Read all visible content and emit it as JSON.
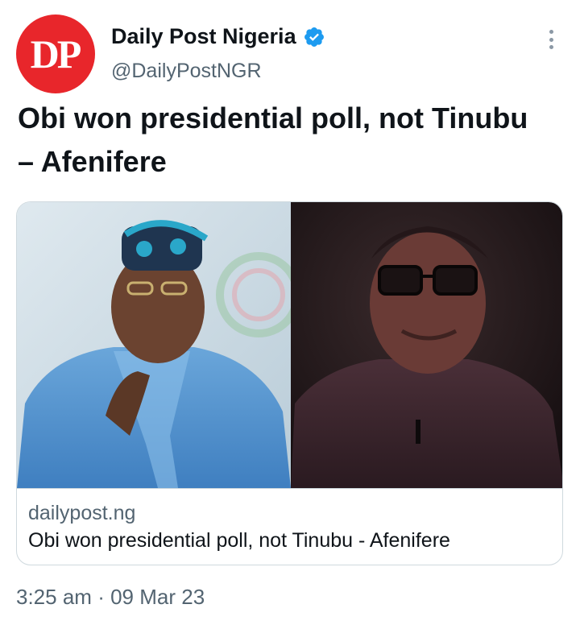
{
  "author": {
    "display_name": "Daily Post Nigeria",
    "handle": "@DailyPostNGR",
    "avatar_text": "DP",
    "verified": true
  },
  "tweet": {
    "text": "Obi won presidential poll, not Tinubu – Afenifere"
  },
  "card": {
    "domain": "dailypost.ng",
    "title": "Obi won presidential poll, not Tinubu - Afenifere"
  },
  "meta": {
    "time": "3:25 am",
    "separator": "·",
    "date": "09 Mar 23"
  },
  "colors": {
    "avatar_bg": "#e8262b",
    "verified_blue": "#1d9bf0",
    "secondary_text": "#536471",
    "border": "#cfd9de"
  },
  "icons": {
    "verified": "verified-badge-icon",
    "more": "more-options-icon"
  }
}
